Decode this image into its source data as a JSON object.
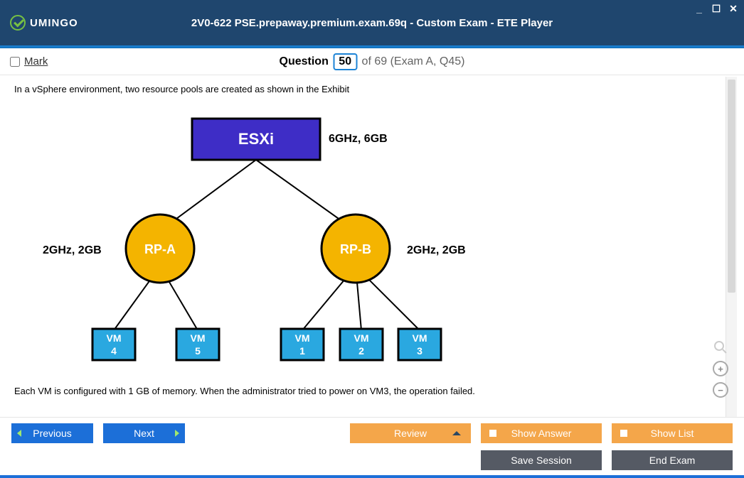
{
  "app": {
    "brand": "UMINGO",
    "title": "2V0-622 PSE.prepaway.premium.exam.69q - Custom Exam - ETE Player"
  },
  "questionBar": {
    "markLabel": "Mark",
    "prefix": "Question",
    "number": "50",
    "suffix": "of 69 (Exam A, Q45)"
  },
  "question": {
    "intro": "In a vSphere environment, two resource pools are created as shown in the Exhibit",
    "followup": "Each VM is configured with 1 GB of memory. When the administrator tried to power on VM3, the operation failed."
  },
  "diagram": {
    "host": {
      "label": "ESXi",
      "spec": "6GHz, 6GB"
    },
    "pools": [
      {
        "label": "RP-A",
        "spec": "2GHz, 2GB",
        "vms": [
          "VM 4",
          "VM 5"
        ]
      },
      {
        "label": "RP-B",
        "spec": "2GHz, 2GB",
        "vms": [
          "VM 1",
          "VM 2",
          "VM 3"
        ]
      }
    ]
  },
  "buttons": {
    "previous": "Previous",
    "next": "Next",
    "review": "Review",
    "showAnswer": "Show Answer",
    "showList": "Show List",
    "saveSession": "Save Session",
    "endExam": "End Exam"
  }
}
